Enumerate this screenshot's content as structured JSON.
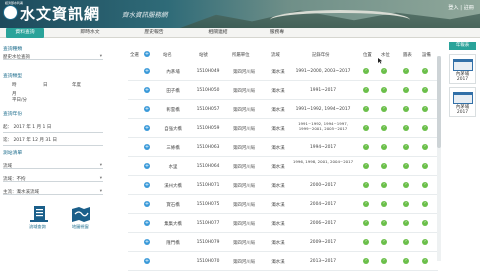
{
  "header": {
    "logo_small": "經濟部水利署",
    "title": "水文資訊網",
    "subtitle": "齊水資訊服務網",
    "user": "登入 | 註冊"
  },
  "nav": {
    "items": [
      {
        "label": "資料查詢",
        "active": true
      },
      {
        "label": "即時水文",
        "active": false
      },
      {
        "label": "歷史報告",
        "active": false
      },
      {
        "label": "相關連結",
        "active": false
      },
      {
        "label": "服務專",
        "active": false
      }
    ]
  },
  "sidebar": {
    "query_type_title": "查詢種類",
    "query_type_value": "歷史水位查詢",
    "period_title": "查詢類型",
    "period_options": [
      "時",
      "日",
      "年度"
    ],
    "period_options2": [
      "月",
      "平日/分"
    ],
    "year_title": "查詢年份",
    "start_label": "起：",
    "end_label": "迄：",
    "start_year": "2017",
    "start_month": "1",
    "start_day": "1",
    "end_year": "2017",
    "end_month": "12",
    "end_day": "31",
    "year_unit": "年",
    "month_unit": "月",
    "day_unit": "日",
    "station_title": "測站清單",
    "basin_label": "流域",
    "basin_value": "流域：不拘",
    "river_value": "主流：濁水溪流域",
    "icon1_label": "流域查詢",
    "icon2_label": "地圖視窗"
  },
  "table": {
    "headers": [
      "全選",
      "站名",
      "站號",
      "所屬單位",
      "流域",
      "記錄年份",
      "位置",
      "水位",
      "圖表",
      "設備"
    ],
    "rows": [
      {
        "name": "內茅埔",
        "id": "1510H049",
        "unit": "第四河川局",
        "basin": "濁水溪",
        "years": "1991~2000, 2003~2017",
        "small": false
      },
      {
        "name": "田子橋",
        "id": "1510H050",
        "unit": "第四河川局",
        "basin": "濁水溪",
        "years": "1991~2017",
        "small": false
      },
      {
        "name": "彰雲橋",
        "id": "1510H057",
        "unit": "第四河川局",
        "basin": "濁水溪",
        "years": "1991~1992, 1994~2017",
        "small": false
      },
      {
        "name": "自強大橋",
        "id": "1510H059",
        "unit": "第四河川局",
        "basin": "濁水溪",
        "years": "1991~1992, 1994~1997, 1999~2001, 2005~2017",
        "small": true
      },
      {
        "name": "三條橋",
        "id": "1510H063",
        "unit": "第四河川局",
        "basin": "濁水溪",
        "years": "1994~2017",
        "small": false
      },
      {
        "name": "水里",
        "id": "1510H064",
        "unit": "第四河川局",
        "basin": "濁水溪",
        "years": "1996, 1998, 2001, 2004~2017",
        "small": true
      },
      {
        "name": "溪州大橋",
        "id": "1510H071",
        "unit": "第四河川局",
        "basin": "濁水溪",
        "years": "2000~2017",
        "small": false
      },
      {
        "name": "寶石橋",
        "id": "1510H075",
        "unit": "第四河川局",
        "basin": "濁水溪",
        "years": "2004~2017",
        "small": false
      },
      {
        "name": "集集大橋",
        "id": "1510H077",
        "unit": "第四河川局",
        "basin": "濁水溪",
        "years": "2006~2017",
        "small": false
      },
      {
        "name": "隆門橋",
        "id": "1510H079",
        "unit": "第四河川局",
        "basin": "濁水溪",
        "years": "2009~2017",
        "small": false
      },
      {
        "name": "",
        "id": "1510H070",
        "unit": "第四河川局",
        "basin": "濁水溪",
        "years": "2013~2017",
        "small": false
      }
    ]
  },
  "right_panel": {
    "title": "年報表",
    "cards": [
      {
        "label1": "內茅埔",
        "label2": "2017"
      },
      {
        "label1": "內茅埔",
        "label2": "2017"
      }
    ]
  },
  "colors": {
    "accent": "#2aa39a",
    "link": "#1c6c8c",
    "go": "#6bbf4a",
    "plus": "#3a9ad9"
  }
}
